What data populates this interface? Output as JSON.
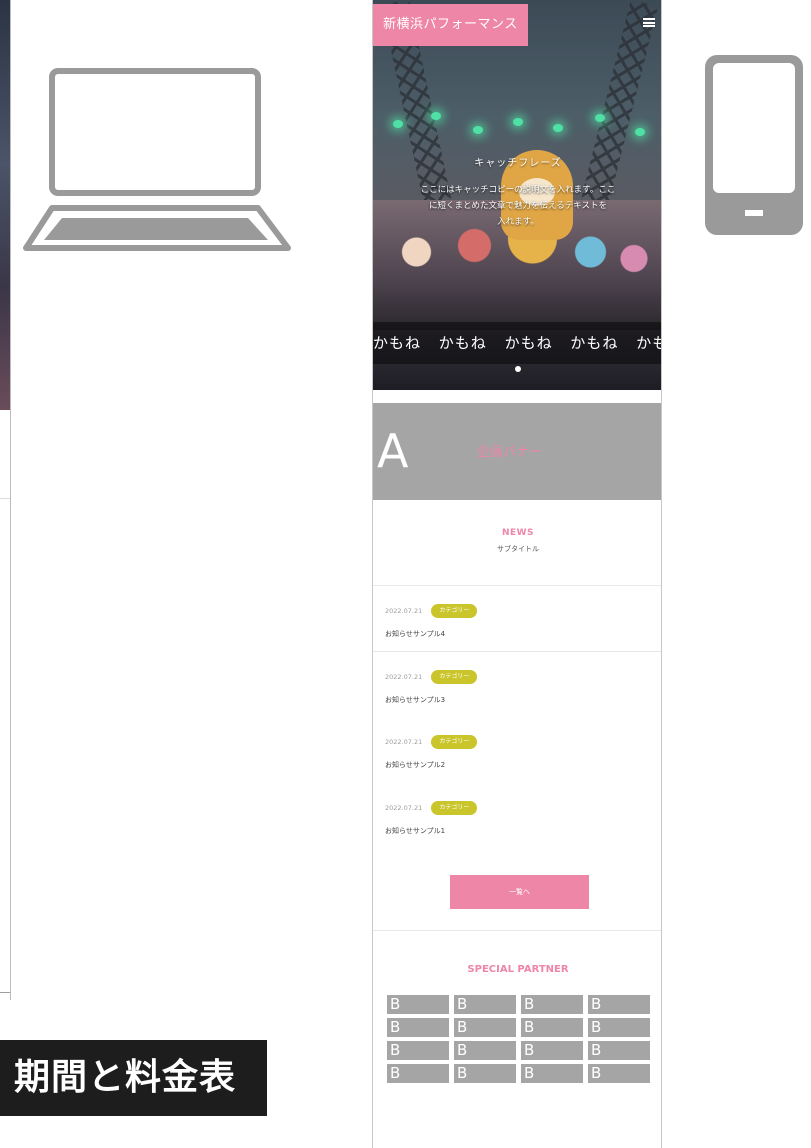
{
  "left_preview": {},
  "icons": {
    "laptop": "laptop-icon",
    "phone": "smartphone-icon"
  },
  "price_banner": "期間と料金表",
  "mock": {
    "site_title": "新横浜パフォーマンス",
    "hero": {
      "caption_title": "キャッチフレーズ",
      "caption_lines": [
        "ここにはキャッチコピーの説明文を入れます。ここ",
        "に短くまとめた文章で魅力を伝えるテキストを",
        "入れます。"
      ],
      "ticker": [
        "かもね",
        "かもね",
        "かもね",
        "かもね",
        "かもね",
        "か"
      ]
    },
    "a_block": {
      "letter": "A",
      "label": "企画バナー"
    },
    "news": {
      "title": "NEWS",
      "subtitle": "サブタイトル",
      "items": [
        {
          "date": "2022.07.21",
          "tag": "カテゴリー",
          "title": "お知らせサンプル4"
        },
        {
          "date": "2022.07.21",
          "tag": "カテゴリー",
          "title": "お知らせサンプル3"
        },
        {
          "date": "2022.07.21",
          "tag": "カテゴリー",
          "title": "お知らせサンプル2"
        },
        {
          "date": "2022.07.21",
          "tag": "カテゴリー",
          "title": "お知らせサンプル1"
        }
      ]
    },
    "more_button": "一覧へ",
    "partner": {
      "title": "SPECIAL PARTNER",
      "cells": [
        "B",
        "B",
        "B",
        "B",
        "B",
        "B",
        "B",
        "B",
        "B",
        "B",
        "B",
        "B",
        "B",
        "B",
        "B",
        "B"
      ]
    }
  },
  "colors": {
    "accent": "#ee86a8",
    "tag": "#c9c52a",
    "gray_block": "#a5a5a5",
    "banner_bg": "#1d1d1d"
  }
}
